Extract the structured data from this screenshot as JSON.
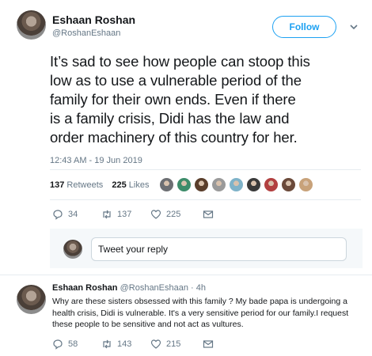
{
  "tweet": {
    "author_name": "Eshaan Roshan",
    "author_handle": "@RoshanEshaan",
    "follow_label": "Follow",
    "text_lines": [
      "It’s sad to see how people can stoop this",
      "low as to use a vulnerable period of the",
      "family for their own ends.  Even if there",
      "is a family crisis, Didi has the law and",
      "order machinery of this country for her."
    ],
    "timestamp": "12:43 AM - 19 Jun 2019",
    "retweets_count": "137",
    "retweets_label": "Retweets",
    "likes_count": "225",
    "likes_label": "Likes",
    "actions": {
      "replies": "34",
      "retweets": "137",
      "likes": "225"
    },
    "icons": [
      "reply-icon",
      "retweet-icon",
      "like-icon",
      "direct-message-icon",
      "chevron-down-icon"
    ],
    "accent_color": "#1da1f2"
  },
  "likers": [
    "#6d6f73",
    "#3d8c6a",
    "#5a3e2b",
    "#9a9a9a",
    "#7fb3c9",
    "#3a3a3a",
    "#b24040",
    "#6b4a3a",
    "#c8a27a"
  ],
  "reply_box": {
    "placeholder": "Tweet your reply"
  },
  "reply": {
    "author_name": "Eshaan Roshan",
    "author_handle": "@RoshanEshaan",
    "time": "4h",
    "text_lines": [
      "Why are these sisters obsessed with this family ? My bade papa is undergoing a",
      "health crisis, Didi is vulnerable. It's a very sensitive period for our family.I request",
      "these people to be sensitive and not act as vultures."
    ],
    "actions": {
      "replies": "58",
      "retweets": "143",
      "likes": "215"
    }
  }
}
